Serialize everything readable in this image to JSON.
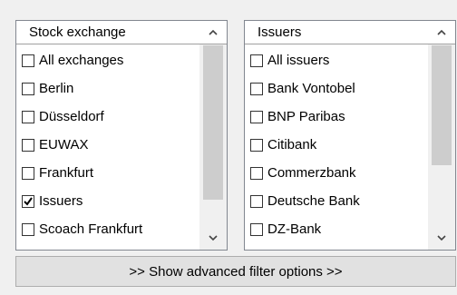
{
  "stock_exchange_list": {
    "header": "Stock exchange",
    "items": [
      {
        "label": "All exchanges",
        "checked": false
      },
      {
        "label": "Berlin",
        "checked": false
      },
      {
        "label": "Düsseldorf",
        "checked": false
      },
      {
        "label": "EUWAX",
        "checked": false
      },
      {
        "label": "Frankfurt",
        "checked": false
      },
      {
        "label": "Issuers",
        "checked": true
      },
      {
        "label": "Scoach Frankfurt",
        "checked": false
      }
    ]
  },
  "issuers_list": {
    "header": "Issuers",
    "items": [
      {
        "label": "All issuers",
        "checked": false
      },
      {
        "label": "Bank Vontobel",
        "checked": false
      },
      {
        "label": "BNP Paribas",
        "checked": false
      },
      {
        "label": "Citibank",
        "checked": false
      },
      {
        "label": "Commerzbank",
        "checked": false
      },
      {
        "label": "Deutsche Bank",
        "checked": false
      },
      {
        "label": "DZ-Bank",
        "checked": false
      }
    ]
  },
  "advanced_button": {
    "label": ">> Show advanced filter options >>"
  },
  "icons": {
    "scroll_up": "chevron-up-icon",
    "scroll_down": "chevron-down-icon",
    "checkmark": "checkmark-icon"
  },
  "colors": {
    "background": "#f0f0f0",
    "list_background": "#ffffff",
    "scroll_thumb": "#cdcdcd",
    "button_background": "#e1e1e1"
  }
}
